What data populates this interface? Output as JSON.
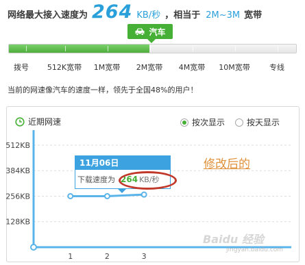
{
  "headline": {
    "prefix": "网络最大接入速度为",
    "speed_value": "264",
    "speed_unit": "KB/秒",
    "middle": "，相当于",
    "range": "2M~3M",
    "suffix": "宽带"
  },
  "level_badge": {
    "label": "汽车",
    "icon": "car-icon",
    "color": "#45b035"
  },
  "progress": {
    "fill_fraction": 0.49,
    "fill_color": "#4fae3d"
  },
  "scale_labels": [
    "拨号",
    "512K宽带",
    "1M宽带",
    "2M宽带",
    "4M宽带",
    "10M宽带",
    "专线"
  ],
  "rank_text": "当前的网速像汽车的速度一样，领先于全国48%的用户！",
  "panel": {
    "title": "近期网速",
    "title_icon": "clock-icon",
    "radio_by_count": "按次显示",
    "radio_by_day": "按天显示",
    "selected": "by_count"
  },
  "chart_data": {
    "type": "line",
    "title": "近期网速",
    "x": [
      1,
      2,
      3
    ],
    "categories": [
      "1",
      "2",
      "3"
    ],
    "values": [
      256,
      256,
      264
    ],
    "y_tick_labels": [
      "512KB",
      "384KB",
      "256KB",
      "128KB"
    ],
    "y_ticks": [
      512,
      384,
      256,
      128
    ],
    "ylim": [
      0,
      560
    ],
    "x_range": [
      0,
      7
    ],
    "grid": "horizontal dashed",
    "line_color": "#5ab4ea"
  },
  "tooltip": {
    "date": "11月06日",
    "label": "下载速度为",
    "value": "264",
    "unit": "KB/秒"
  },
  "annotation": "修改后的",
  "watermark": {
    "main": "Baidu 经验",
    "sub": "jingyan.baidu.com"
  }
}
